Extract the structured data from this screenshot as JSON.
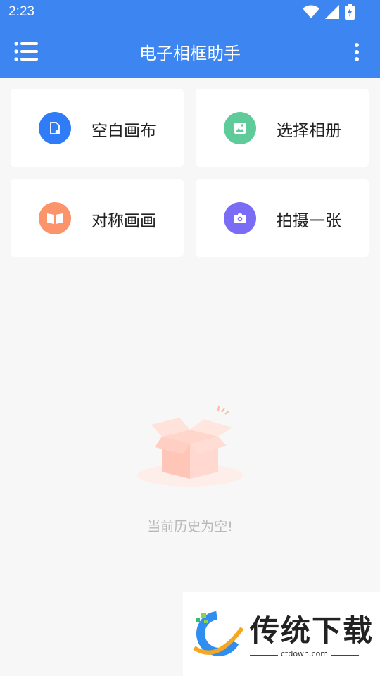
{
  "status_bar": {
    "time": "2:23"
  },
  "app_bar": {
    "title": "电子相框助手"
  },
  "cards": [
    {
      "label": "空白画布",
      "icon": "new-canvas-icon",
      "color": "#2f7cf6"
    },
    {
      "label": "选择相册",
      "icon": "image-icon",
      "color": "#5fca9a"
    },
    {
      "label": "对称画画",
      "icon": "symmetry-book-icon",
      "color": "#fb946a"
    },
    {
      "label": "拍摄一张",
      "icon": "camera-icon",
      "color": "#7b6cf6"
    }
  ],
  "empty_state": {
    "text": "当前历史为空!"
  },
  "watermark": {
    "name": "传统下载",
    "domain": "ctdown.com"
  },
  "colors": {
    "primary": "#3d86f2",
    "background": "#f7f7f7"
  }
}
